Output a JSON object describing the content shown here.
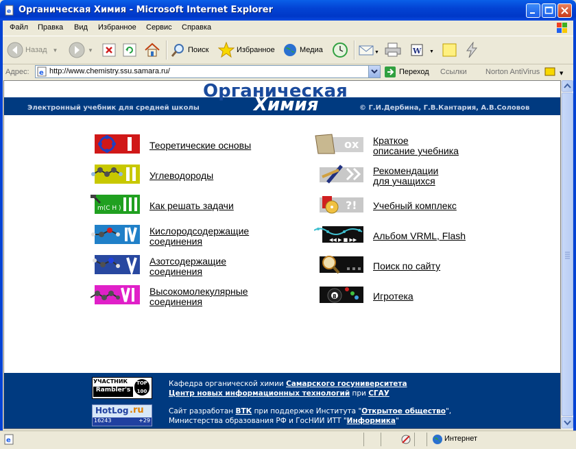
{
  "window": {
    "title": "Органическая Химия - Microsoft Internet Explorer"
  },
  "menu": [
    "Файл",
    "Правка",
    "Вид",
    "Избранное",
    "Сервис",
    "Справка"
  ],
  "toolbar": {
    "back": "Назад",
    "search": "Поиск",
    "favorites": "Избранное",
    "media": "Медиа"
  },
  "address": {
    "label": "Адрес:",
    "url": "http://www.chemistry.ssu.samara.ru/",
    "go": "Переход",
    "links": "Ссылки",
    "norton": "Norton AntiVirus"
  },
  "page": {
    "logo_line1": "Органическая",
    "logo_line2": "Химия",
    "subtitle": "Электронный учебник для средней школы",
    "copyright": "© Г.И.Дербина, Г.В.Кантария, А.В.Соловов",
    "left_items": [
      {
        "line1": "Теоретические основы",
        "line2": "",
        "roman": "I",
        "color": "#d01818"
      },
      {
        "line1": "Углеводороды",
        "line2": "",
        "roman": "II",
        "color": "#c8c800"
      },
      {
        "line1": "Как решать задачи",
        "line2": "",
        "roman": "III",
        "color": "#20a020"
      },
      {
        "line1": "Кислородсодержащие",
        "line2": "соединения",
        "roman": "IV",
        "color": "#2080c8"
      },
      {
        "line1": "Азотсодержащие",
        "line2": "соединения",
        "roman": "V",
        "color": "#2848a0"
      },
      {
        "line1": "Высокомолекулярные",
        "line2": "соединения",
        "roman": "VI",
        "color": "#e020c8"
      }
    ],
    "right_items": [
      {
        "line1": "Краткое",
        "line2": "описание учебника"
      },
      {
        "line1": "Рекомендации",
        "line2": "для учащихся"
      },
      {
        "line1": "Учебный комплекс",
        "line2": ""
      },
      {
        "line1": "Альбом VRML, Flash",
        "line2": ""
      },
      {
        "line1": "Поиск по сайту",
        "line2": ""
      },
      {
        "line1": "Игротека",
        "line2": ""
      }
    ],
    "footer": {
      "line1_text": "Кафедра органической химии ",
      "line1_link": "Самарского госуниверситета",
      "line2_link": "Центр новых информационных технологий",
      "line2_mid": " при ",
      "line2_link2": "СГАУ",
      "line3_text": "Сайт разработан ",
      "line3_link": "ВТК",
      "line3_mid": " при поддержке Института \"",
      "line3_link2": "Открытое общество",
      "line3_end": "\",",
      "line4_text": "Министерства образования РФ и ГосНИИ ИТТ \"",
      "line4_link": "Информика",
      "line4_end": "\"",
      "rambler_label": "УЧАСТНИК",
      "rambler_name": "Rambler's",
      "rambler_top": "TOP 100",
      "hotlog_name": "HotLog",
      "hotlog_ru": ".ru",
      "hotlog_count": "16243",
      "hotlog_delta": "+29"
    }
  },
  "status": {
    "zone": "Интернет"
  }
}
